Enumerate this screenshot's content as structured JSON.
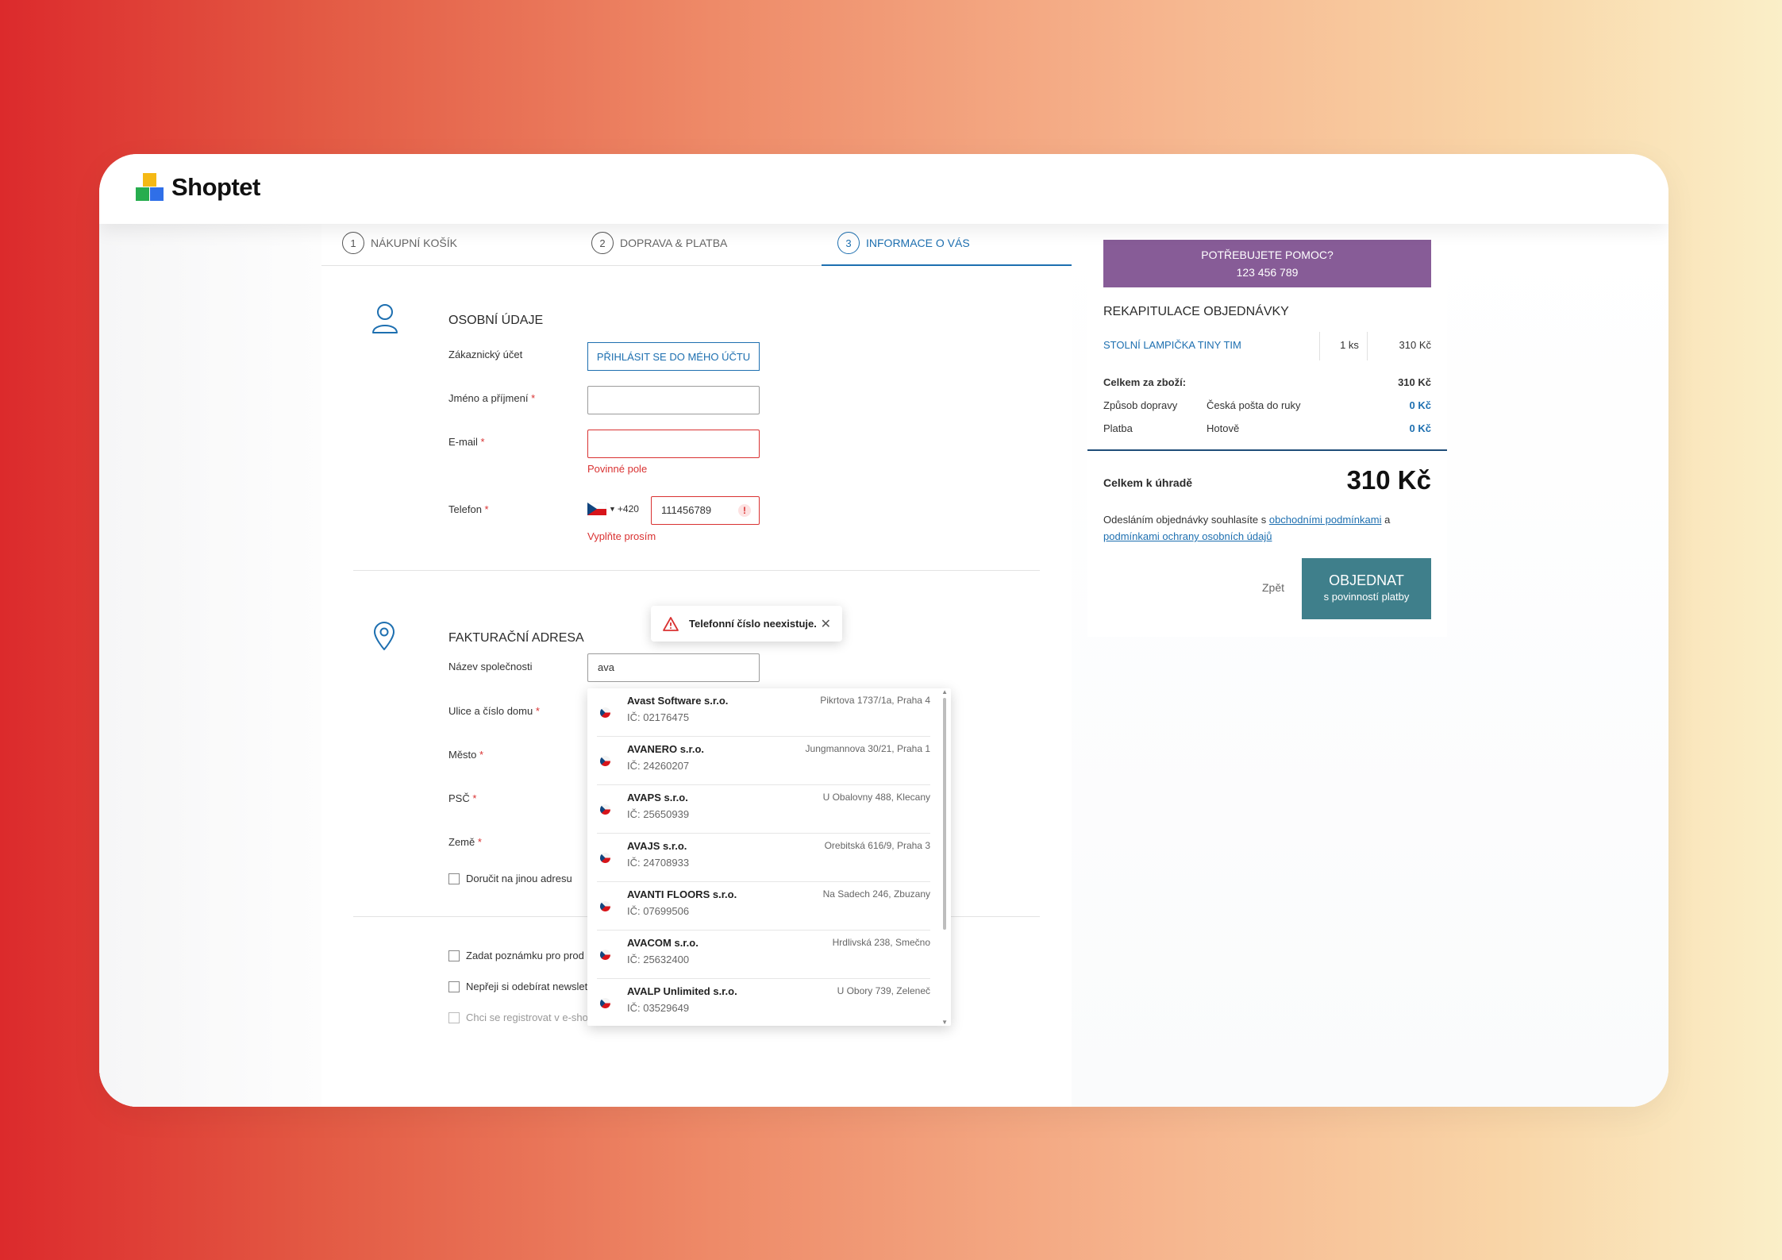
{
  "brand": {
    "name": "Shoptet"
  },
  "steps": [
    {
      "num": "1",
      "label": "NÁKUPNÍ KOŠÍK"
    },
    {
      "num": "2",
      "label": "DOPRAVA & PLATBA"
    },
    {
      "num": "3",
      "label": "INFORMACE O VÁS"
    }
  ],
  "personal": {
    "title": "OSOBNÍ ÚDAJE",
    "account_label": "Zákaznický účet",
    "login_button": "PŘIHLÁSIT SE DO MÉHO ÚČTU",
    "name_label": "Jméno a příjmení",
    "email_label": "E-mail",
    "email_error": "Povinné pole",
    "phone_label": "Telefon",
    "phone_prefix": "+420",
    "phone_value": "111456789",
    "phone_error": "Vyplňte prosím",
    "phone_tooltip": "Telefonní číslo neexistuje.",
    "required_mark": "*"
  },
  "billing": {
    "title": "FAKTURAČNÍ ADRESA",
    "company_label": "Název společnosti",
    "company_value": "ava",
    "street_label": "Ulice a číslo domu",
    "city_label": "Město",
    "zip_label": "PSČ",
    "country_label": "Země",
    "other_address": "Doručit na jinou adresu"
  },
  "extra": {
    "note": "Zadat poznámku pro prod",
    "newsletter": "Nepřeji si odebírat newslet",
    "register": "Chci se registrovat v e-shop"
  },
  "suggestions": [
    {
      "name": "Avast Software s.r.o.",
      "ic": "IČ: 02176475",
      "address": "Pikrtova 1737/1a, Praha 4"
    },
    {
      "name": "AVANERO s.r.o.",
      "ic": "IČ: 24260207",
      "address": "Jungmannova 30/21, Praha 1"
    },
    {
      "name": "AVAPS s.r.o.",
      "ic": "IČ: 25650939",
      "address": "U Obalovny 488, Klecany"
    },
    {
      "name": "AVAJS s.r.o.",
      "ic": "IČ: 24708933",
      "address": "Orebitská 616/9, Praha 3"
    },
    {
      "name": "AVANTI FLOORS s.r.o.",
      "ic": "IČ: 07699506",
      "address": "Na Sadech 246, Zbuzany"
    },
    {
      "name": "AVACOM s.r.o.",
      "ic": "IČ: 25632400",
      "address": "Hrdlivská 238, Smečno"
    },
    {
      "name": "AVALP Unlimited s.r.o.",
      "ic": "IČ: 03529649",
      "address": "U Obory 739, Zeleneč"
    }
  ],
  "sidebar": {
    "help_title": "POTŘEBUJETE POMOC?",
    "help_phone": "123 456 789",
    "recap_title": "REKAPITULACE OBJEDNÁVKY",
    "product": "STOLNÍ LAMPIČKA TINY TIM",
    "qty": "1 ks",
    "product_price": "310 Kč",
    "goods_label": "Celkem za zboží:",
    "goods_value": "310 Kč",
    "shipping_label": "Způsob dopravy",
    "shipping_method": "Česká pošta do ruky",
    "shipping_price": "0 Kč",
    "payment_label": "Platba",
    "payment_method": "Hotově",
    "payment_price": "0 Kč",
    "total_label": "Celkem k úhradě",
    "total_value": "310 Kč",
    "terms_pre": "Odesláním objednávky souhlasíte s ",
    "terms_link1": "obchodními podmínkami",
    "terms_mid": " a ",
    "terms_link2": "podmínkami ochrany osobních údajů",
    "back": "Zpět",
    "order_big": "OBJEDNAT",
    "order_small": "s povinností platby"
  },
  "colors": {
    "accent": "#1d6fb0",
    "error": "#d93232",
    "help_bg": "#875c97",
    "order_bg": "#3f7f8b"
  }
}
